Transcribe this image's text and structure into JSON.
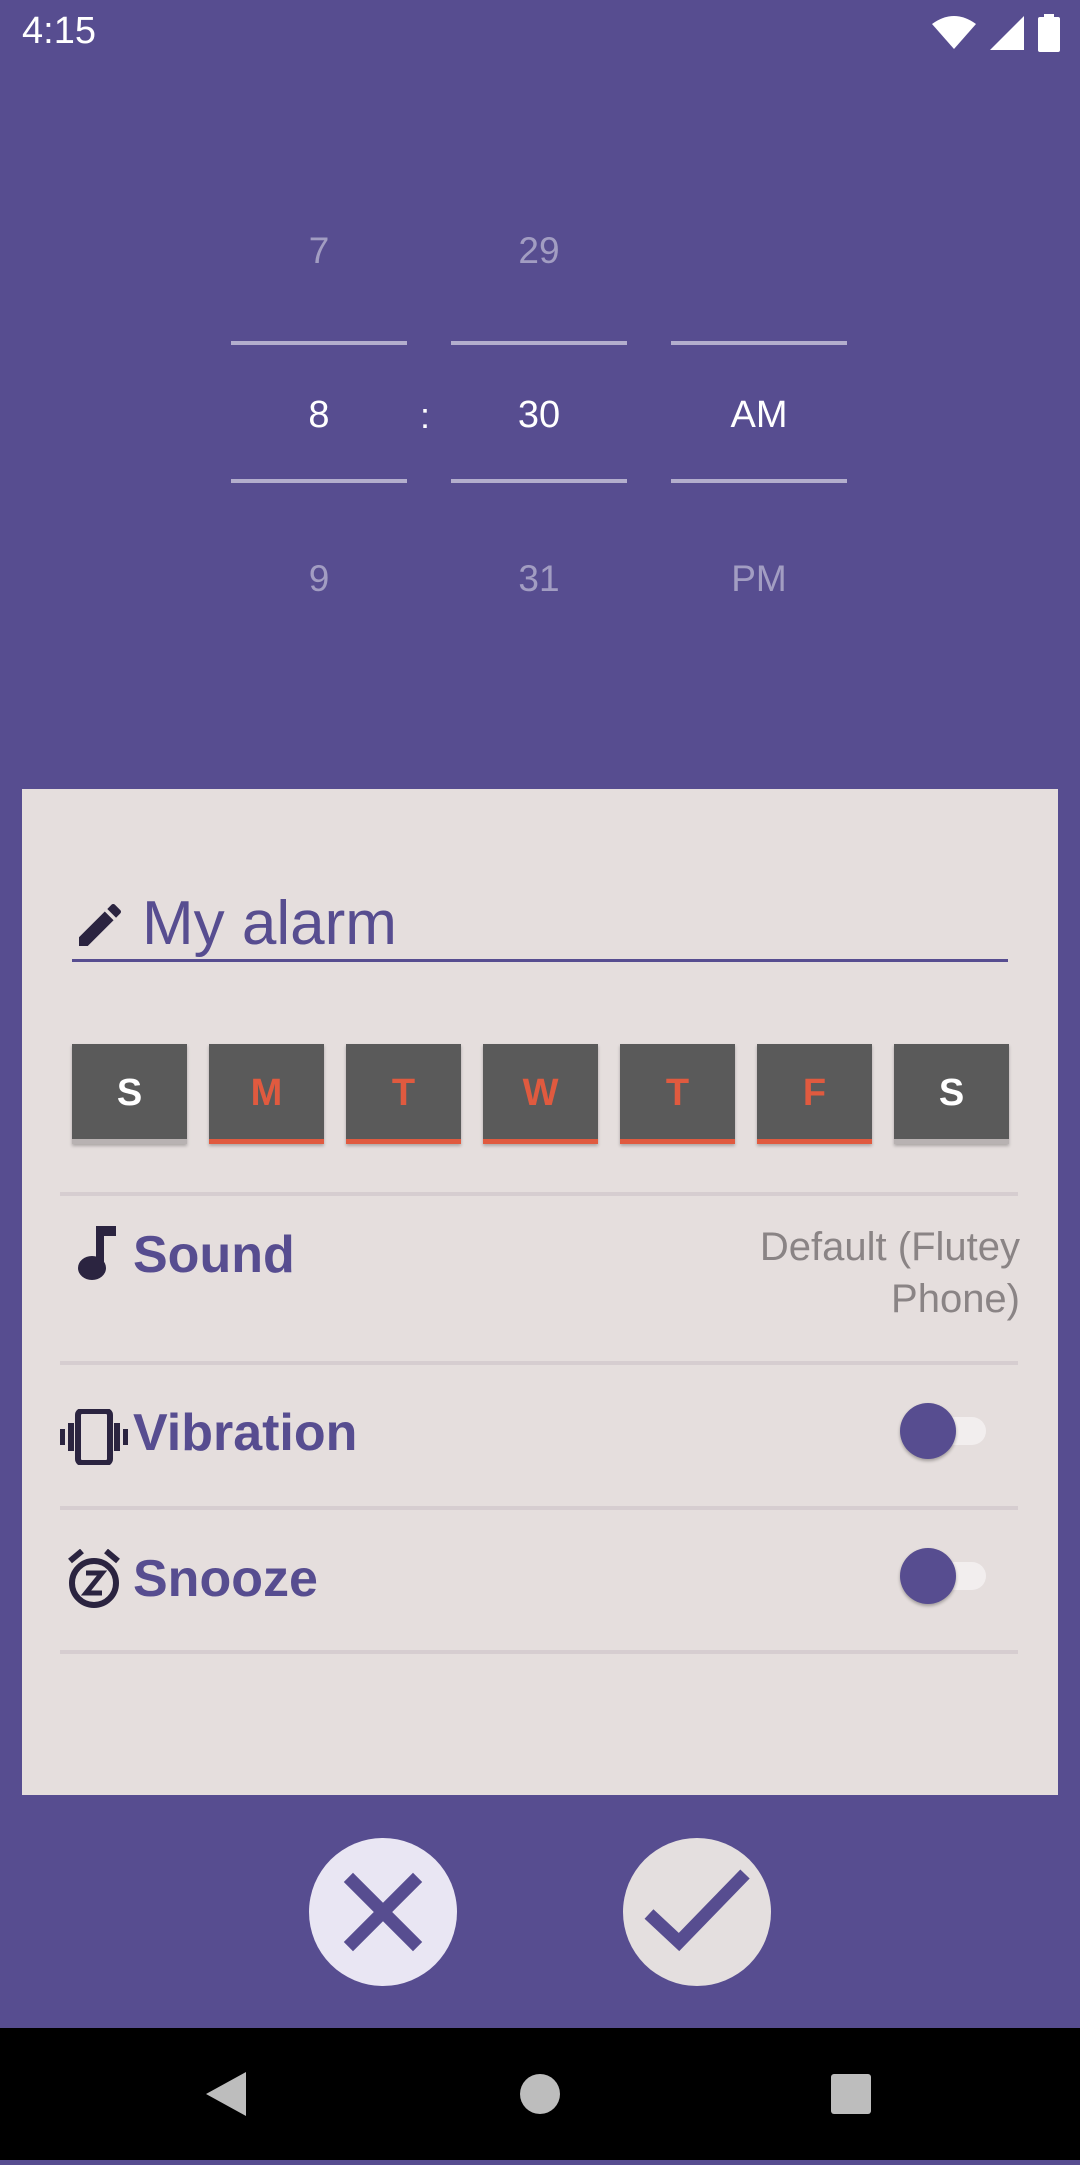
{
  "status_bar": {
    "time": "4:15",
    "icons": [
      "wifi-icon",
      "signal-icon",
      "battery-icon"
    ]
  },
  "time_picker": {
    "hour": {
      "prev": "7",
      "selected": "8",
      "next": "9"
    },
    "separator": ":",
    "minute": {
      "prev": "29",
      "selected": "30",
      "next": "31"
    },
    "period": {
      "prev": "",
      "selected": "AM",
      "next": "PM"
    }
  },
  "alarm_name": {
    "value": "My alarm",
    "icon": "pencil-icon"
  },
  "days": [
    {
      "label": "S",
      "active": false
    },
    {
      "label": "M",
      "active": true
    },
    {
      "label": "T",
      "active": true
    },
    {
      "label": "W",
      "active": true
    },
    {
      "label": "T",
      "active": true
    },
    {
      "label": "F",
      "active": true
    },
    {
      "label": "S",
      "active": false
    }
  ],
  "settings": {
    "sound": {
      "label": "Sound",
      "value": "Default (Flutey Phone)",
      "icon": "music-note-icon"
    },
    "vibration": {
      "label": "Vibration",
      "enabled": false,
      "icon": "vibration-icon"
    },
    "snooze": {
      "label": "Snooze",
      "enabled": false,
      "icon": "snooze-icon"
    }
  },
  "actions": {
    "cancel_icon": "close-icon",
    "confirm_icon": "check-icon"
  },
  "nav": [
    "back-icon",
    "home-icon",
    "recents-icon"
  ],
  "colors": {
    "background": "#574d90",
    "card": "#e5dedd",
    "accent": "#574d90",
    "active_day": "#e05a3f",
    "day_tile": "#5a5a5a"
  }
}
